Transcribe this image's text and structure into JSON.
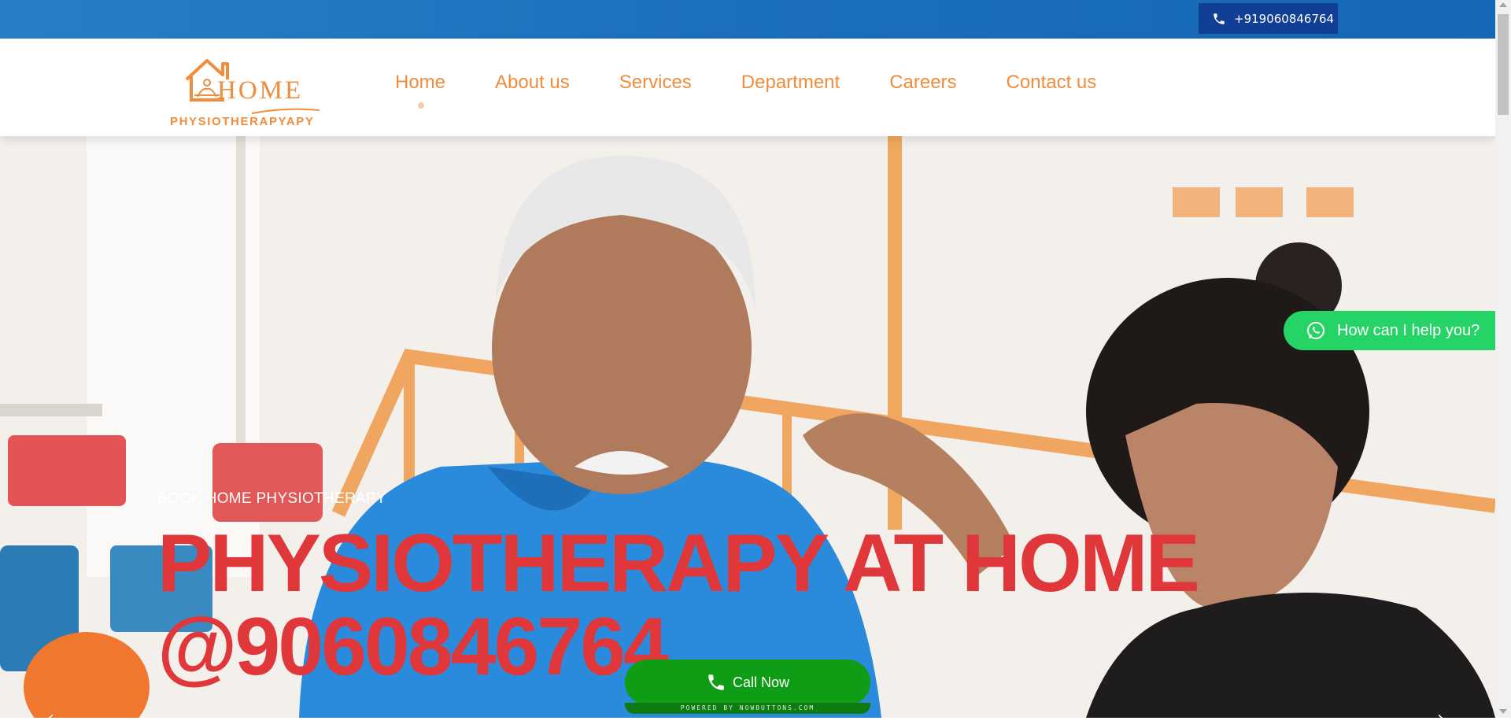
{
  "topbar": {
    "phone": "+919060846764",
    "phone_icon": "phone-icon"
  },
  "logo": {
    "word": "HOME",
    "sub": "PHYSIOTHERAPYAPY"
  },
  "nav": {
    "items": [
      "Home",
      "About us",
      "Services",
      "Department",
      "Careers",
      "Contact us"
    ],
    "active": "Home"
  },
  "hero": {
    "eyebrow": "BOOK HOME PHYSIOTHERAPY",
    "headline_line1": "PHYSIOTHERAPY AT HOME",
    "headline_line2": "@9060846764"
  },
  "whatsapp": {
    "label": "How can I help you?",
    "icon": "whatsapp-icon"
  },
  "callnow": {
    "label": "Call Now",
    "powered": "POWERED BY NOWBUTTONS.COM",
    "icon": "phone-icon"
  },
  "colors": {
    "topbar": "#1c6fbd",
    "phone_pill": "#123f96",
    "nav_text": "#f08c3c",
    "headline": "#e0373a",
    "whatsapp": "#25d366",
    "callnow": "#0f9d15"
  }
}
